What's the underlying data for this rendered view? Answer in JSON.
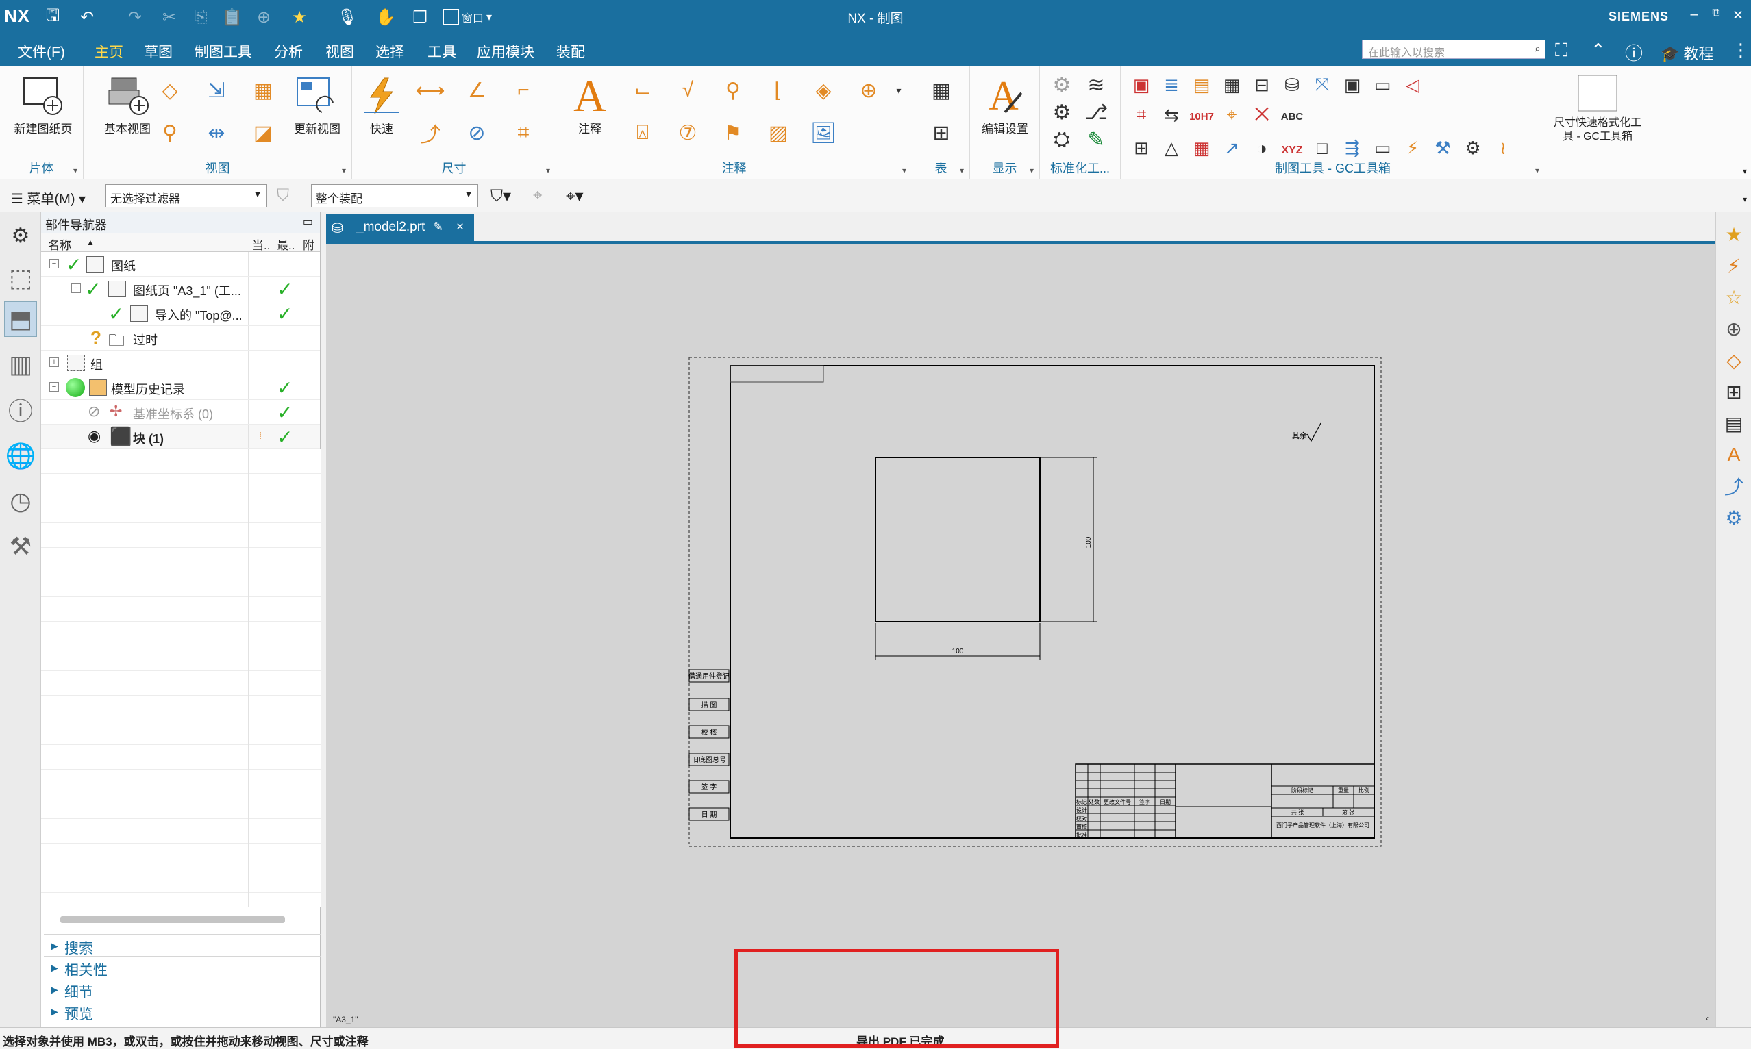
{
  "window": {
    "logo": "NX",
    "title": "NX - 制图",
    "brand": "SIEMENS",
    "window_menu": "窗口",
    "minimize": "–",
    "restore": "⧉",
    "close": "✕"
  },
  "menubar": {
    "file": "文件(F)",
    "tabs": [
      "主页",
      "草图",
      "制图工具",
      "分析",
      "视图",
      "选择",
      "工具",
      "应用模块",
      "装配"
    ],
    "search_placeholder": "在此输入以搜索",
    "tutorial": "教程"
  },
  "ribbon": {
    "groups": {
      "sheet": "片体",
      "view": "视图",
      "dimension": "尺寸",
      "annotation": "注释",
      "table": "表",
      "display": "显示",
      "std": "标准化工...",
      "gc": "制图工具 - GC工具箱"
    },
    "buttons": {
      "new_sheet": "新建图纸页",
      "base_view": "基本视图",
      "update_view": "更新视图",
      "rapid": "快速",
      "note": "注释",
      "edit_settings": "编辑设置",
      "fast_format": "尺寸快速格式化工具 - GC工具箱"
    },
    "tol_label": "10H7",
    "text_abc": "ABC",
    "text_xyz": "XYZ"
  },
  "toolbar2": {
    "menu": "菜单(M)",
    "filter": "无选择过滤器",
    "assembly": "整个装配"
  },
  "navigator": {
    "title": "部件导航器",
    "col_name": "名称",
    "col_current": "当..",
    "col_latest": "最..",
    "col_attach": "附",
    "rows": [
      {
        "label": "图纸"
      },
      {
        "label": "图纸页 \"A3_1\" (工..."
      },
      {
        "label": "导入的 \"Top@..."
      },
      {
        "label": "过时"
      },
      {
        "label": "组"
      },
      {
        "label": "模型历史记录"
      },
      {
        "label": "基准坐标系 (0)"
      },
      {
        "label": "块 (1)"
      }
    ],
    "sections": [
      "搜索",
      "相关性",
      "细节",
      "预览"
    ]
  },
  "document": {
    "tab": "_model2.prt",
    "tab_close": "×",
    "sheet_name": "\"A3_1\""
  },
  "drawing": {
    "roughness": "其余",
    "dim_horizontal": "100",
    "dim_vertical": "100",
    "left_boxes": [
      "借通用件登记",
      "描 图",
      "校 核",
      "旧底图总号",
      "签 字",
      "日 期"
    ],
    "title_header": [
      "标记",
      "处数",
      "更改文件号",
      "签字",
      "日期"
    ],
    "title_rows": [
      "设计",
      "校对",
      "审核",
      "批准"
    ],
    "stage_header": [
      "阶段标记",
      "重量",
      "比例"
    ],
    "sheet_count": [
      "共 张",
      "第 张"
    ],
    "company": "西门子产品管理软件（上海）有限公司"
  },
  "status": {
    "prompt": "选择对象并使用 MB3，或双击，或按住并拖动来移动视图、尺寸或注释",
    "message": "导出 PDF 已完成"
  },
  "colors": {
    "title_bar": "#1a6f9f",
    "active_tab": "#ffd84a",
    "highlight": "#e02020",
    "check": "#28b028"
  }
}
